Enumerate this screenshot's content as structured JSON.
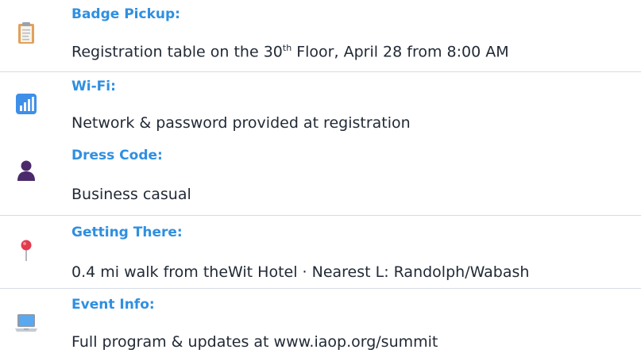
{
  "items": [
    {
      "icon": "clipboard-icon",
      "title": "Badge Pickup:",
      "desc_before": "Registration table on the 30",
      "desc_sup": "th",
      "desc_after": " Floor, April 28 from 8:00 AM"
    },
    {
      "icon": "signal-bars-icon",
      "title": "Wi-Fi:",
      "desc": "Network & password provided at registration"
    },
    {
      "icon": "person-icon",
      "title": "Dress Code:",
      "desc": "Business casual"
    },
    {
      "icon": "map-pin-icon",
      "title": "Getting There:",
      "desc": "0.4 mi walk from theWit Hotel · Nearest L: Randolph/Wabash"
    },
    {
      "icon": "laptop-icon",
      "title": "Event Info:",
      "desc": "Full program & updates at  www.iaop.org/summit"
    }
  ],
  "colors": {
    "title": "#2f8fe0",
    "text": "#222a36",
    "divider": "#d6dbe6"
  }
}
